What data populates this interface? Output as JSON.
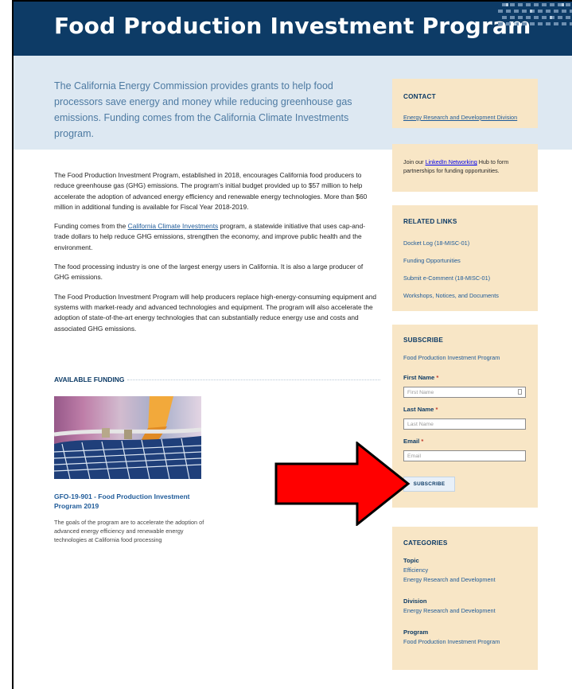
{
  "page": {
    "title": "Food Production Investment Program",
    "intro": "The California Energy Commission provides grants to help food processors save energy and money while reducing greenhouse gas emissions. Funding comes from the California Climate Investments program."
  },
  "body": {
    "p1": "The Food Production Investment Program, established in 2018, encourages California food producers to reduce greenhouse gas (GHG) emissions. The program's initial budget provided up to $57 million to help accelerate the adoption of advanced energy efficiency and renewable energy technologies. More than $60 million in additional funding is available for Fiscal Year 2018-2019.",
    "p2_before": "Funding comes from the ",
    "p2_link": "California Climate Investments",
    "p2_after": " program, a statewide initiative that uses cap-and-trade dollars to help reduce GHG emissions, strengthen the economy, and improve public health and the environment.",
    "p3": "The food processing industry is one of the largest energy users in California. It is also a large producer of GHG emissions.",
    "p4": "The Food Production Investment Program will help producers replace high-energy-consuming equipment and systems with market-ready and advanced technologies and equipment. The program will also accelerate the adoption of state-of-the-art energy technologies that can substantially reduce energy use and costs and associated GHG emissions."
  },
  "funding": {
    "heading": "AVAILABLE FUNDING",
    "card_title": "GFO-19-901 - Food Production Investment Program 2019",
    "card_text": "The goals of the program are to accelerate the adoption of advanced energy efficiency and renewable energy technologies at California food processing"
  },
  "sidebar": {
    "contact_title": "CONTACT",
    "contact_link": "Energy Research and Development Division",
    "join_before": "Join our ",
    "join_link": "LinkedIn Networking",
    "join_after": " Hub to form partnerships for funding opportunities.",
    "related_title": "RELATED LINKS",
    "related_links": [
      "Docket Log (18-MISC-01)",
      "Funding Opportunities",
      "Submit e-Comment (18-MISC-01)",
      "Workshops, Notices, and Documents"
    ],
    "subscribe_title": "SUBSCRIBE",
    "subscribe_sub": "Food Production Investment Program",
    "first_label": "First Name",
    "first_placeholder": "First Name",
    "last_label": "Last Name",
    "last_placeholder": "Last Name",
    "email_label": "Email",
    "email_placeholder": "Email",
    "required_mark": "*",
    "subscribe_button": "SUBSCRIBE",
    "categories_title": "CATEGORIES",
    "topic_label": "Topic",
    "topic_items": [
      "Efficiency",
      "Energy Research and Development"
    ],
    "division_label": "Division",
    "division_items": [
      "Energy Research and Development"
    ],
    "program_label": "Program",
    "program_items": [
      "Food Production Investment Program"
    ]
  },
  "colors": {
    "header_blue": "#0d3b66",
    "intro_bg": "#dde8f2",
    "sidebar_bg": "#f8e6c6",
    "link_blue": "#1f5b99",
    "arrow_red": "#ff0000"
  },
  "icons": {
    "arrow": "red-arrow-icon",
    "pattern": "header-pattern-icon"
  }
}
